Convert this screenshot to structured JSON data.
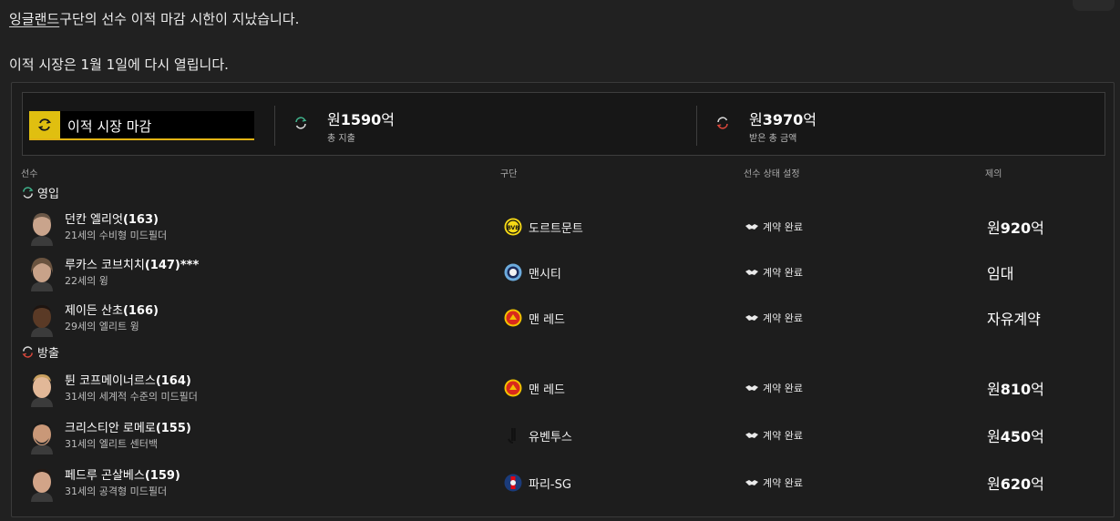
{
  "messages": {
    "line1_prefix": "잉글랜드",
    "line1_rest": " 구단의 선수 이적 마감 시한이 지났습니다.",
    "line2": "이적 시장은 1월 1일에 다시 열립니다."
  },
  "summary": {
    "deadline_label": "이적 시장 마감",
    "spend": {
      "prefix": "원",
      "amount": "1590",
      "suffix": "억",
      "label": "총 지출"
    },
    "received": {
      "prefix": "원",
      "amount": "3970",
      "suffix": "억",
      "label": "받은 총 금액"
    }
  },
  "columns": {
    "player": "선수",
    "club": "구단",
    "status": "선수 상태 설정",
    "offer": "제의"
  },
  "sections": {
    "incoming": "영입",
    "outgoing": "방출"
  },
  "incoming": [
    {
      "name": "던칸 엘리엇",
      "rating": "(163)",
      "desc": "21세의 수비형 미드필더",
      "club": "도르트문트",
      "club_crest": "dortmund-crest",
      "status": "계약 완료",
      "fee_prefix": "원",
      "fee_amount": "920",
      "fee_suffix": "억"
    },
    {
      "name": "루카스 코브치치",
      "rating": "(147)***",
      "desc": "22세의 윙",
      "club": "맨시티",
      "club_crest": "mancity-crest",
      "status": "계약 완료",
      "fee_prefix": "",
      "fee_amount": "",
      "fee_suffix": "임대"
    },
    {
      "name": "제이든 산초",
      "rating": "(166)",
      "desc": "29세의 엘리트 윙",
      "club": "맨 레드",
      "club_crest": "manred-crest",
      "status": "계약 완료",
      "fee_prefix": "",
      "fee_amount": "",
      "fee_suffix": "자유계약"
    }
  ],
  "outgoing": [
    {
      "name": "튄 코프메이너르스",
      "rating": "(164)",
      "desc": "31세의 세계적 수준의 미드필더",
      "club": "맨 레드",
      "club_crest": "manred-crest",
      "status": "계약 완료",
      "fee_prefix": "원",
      "fee_amount": "810",
      "fee_suffix": "억"
    },
    {
      "name": "크리스티안 로메로",
      "rating": "(155)",
      "desc": "31세의 엘리트 센터백",
      "club": "유벤투스",
      "club_crest": "juventus-crest",
      "status": "계약 완료",
      "fee_prefix": "원",
      "fee_amount": "450",
      "fee_suffix": "억"
    },
    {
      "name": "페드루 곤살베스",
      "rating": "(159)",
      "desc": "31세의 공격형 미드필더",
      "club": "파리-SG",
      "club_crest": "psg-crest",
      "status": "계약 완료",
      "fee_prefix": "원",
      "fee_amount": "620",
      "fee_suffix": "억"
    }
  ],
  "colors": {
    "accent": "#e0bf10",
    "incoming": "#3fb08a",
    "outgoing": "#d9463b"
  }
}
